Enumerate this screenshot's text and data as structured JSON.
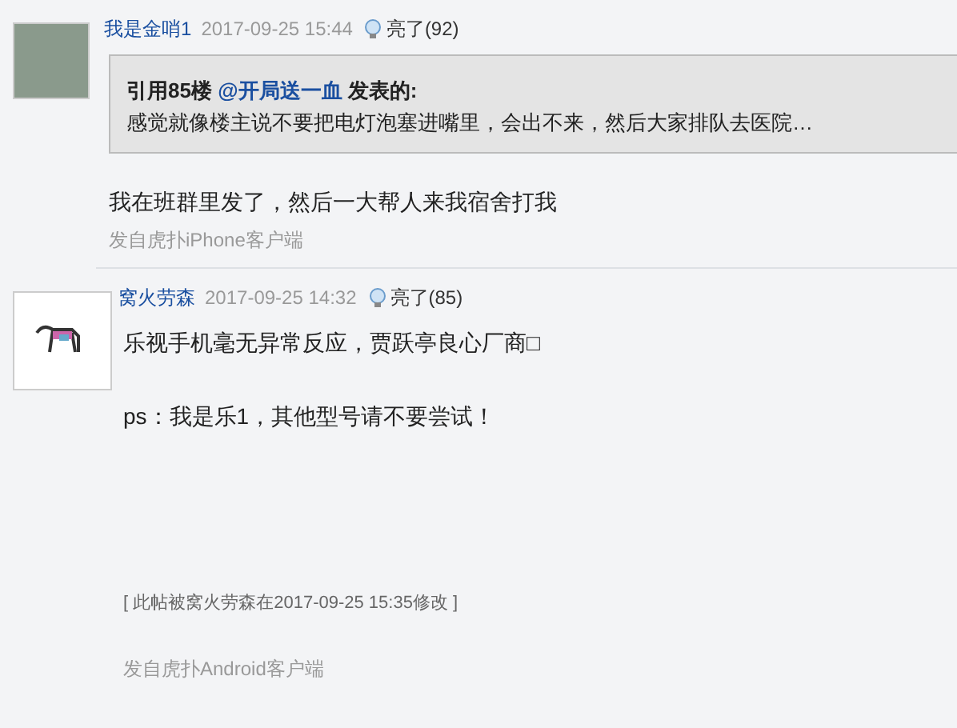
{
  "posts": [
    {
      "author": "我是金哨1",
      "time": "2017-09-25 15:44",
      "likes": "亮了(92)",
      "kind": "photo",
      "quote": {
        "prefix": "引用85楼",
        "user": "@开局送一血",
        "suffix": "发表的:",
        "text": "感觉就像楼主说不要把电灯泡塞进嘴里，会出不来，然后大家排队去医院…"
      },
      "body": [
        "我在班群里发了，然后一大帮人来我宿舍打我"
      ],
      "source": "发自虎扑iPhone客户端"
    },
    {
      "author": "窝火劳森",
      "time": "2017-09-25 14:32",
      "likes": "亮了(85)",
      "kind": "logo",
      "body": [
        "乐视手机毫无异常反应，贾跃亭良心厂商□",
        "ps：我是乐1，其他型号请不要尝试！"
      ],
      "edit_note": "[ 此帖被窝火劳森在2017-09-25 15:35修改 ]",
      "source": "发自虎扑Android客户端"
    }
  ]
}
